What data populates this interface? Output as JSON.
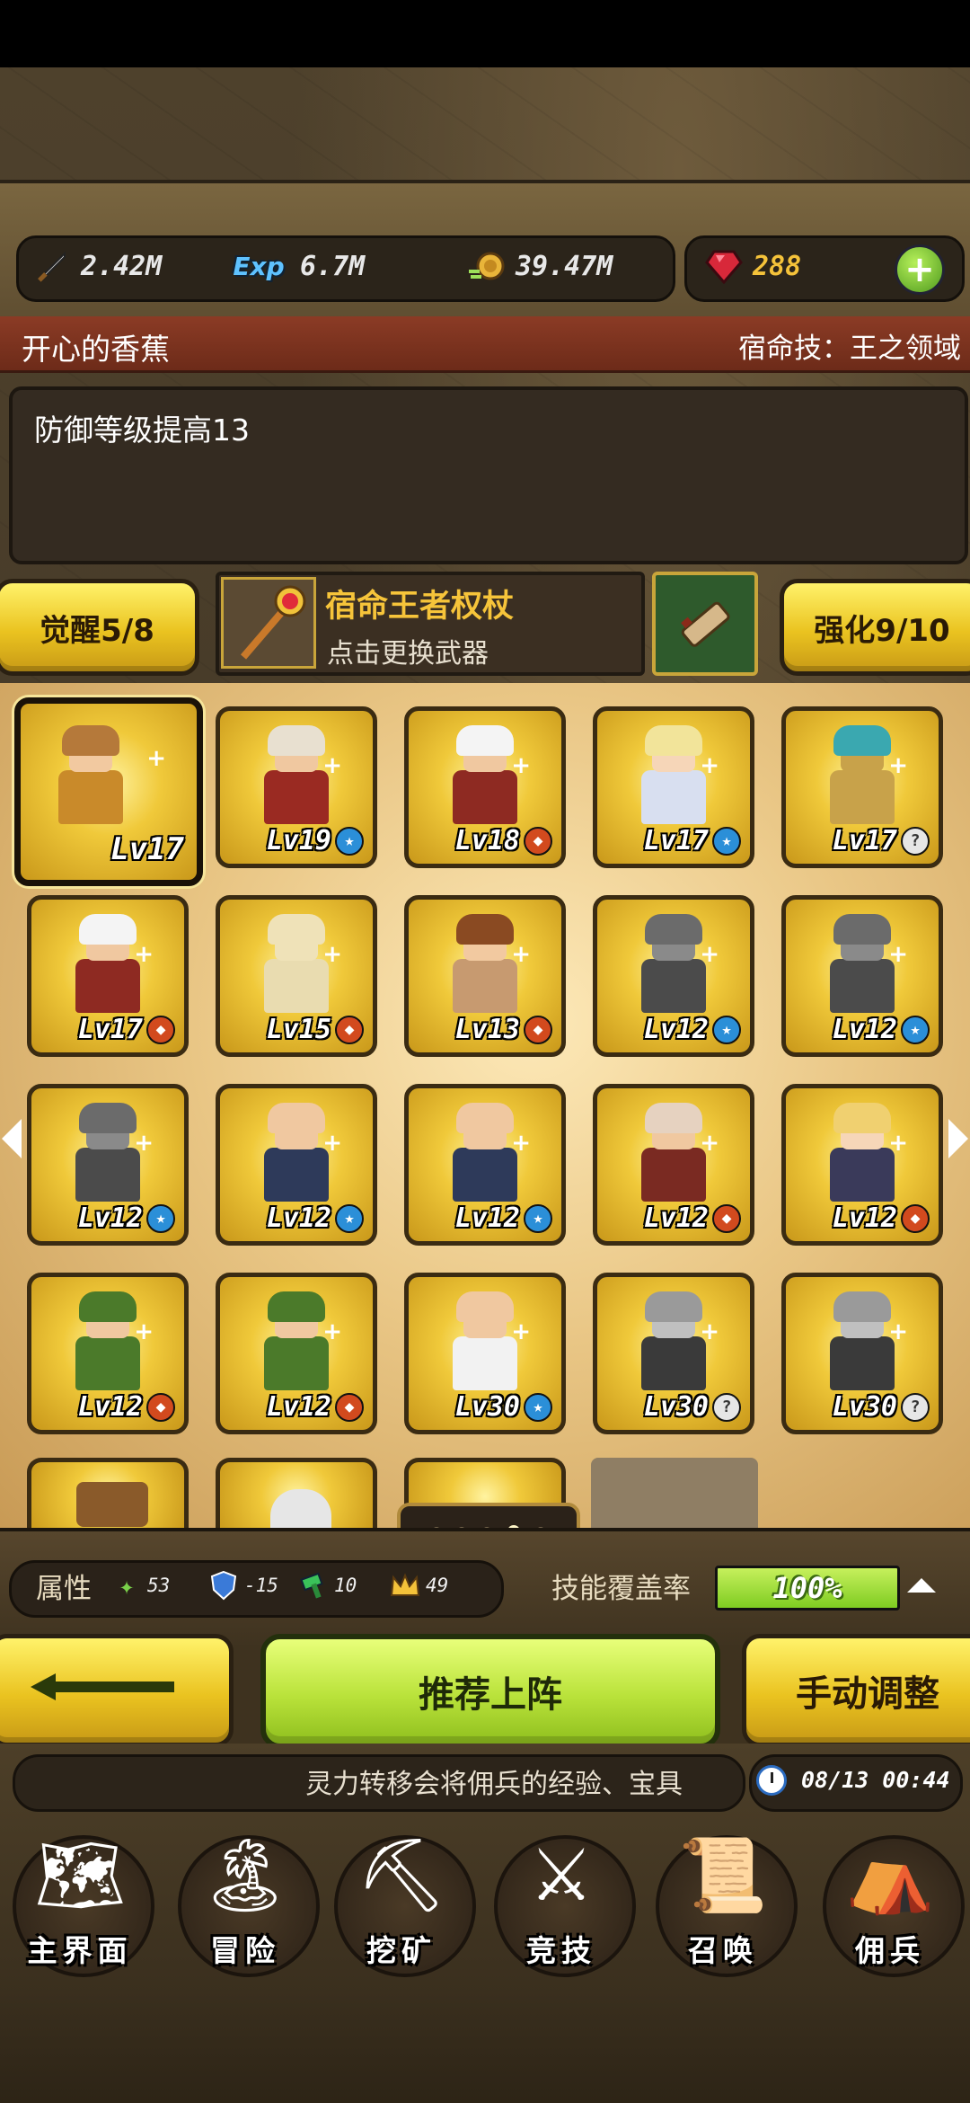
{
  "resources": {
    "attack": "2.42M",
    "exp_icon_text": "Exp",
    "exp": "6.7M",
    "gold": "39.47M",
    "gems": "288",
    "plus": "+"
  },
  "hero": {
    "name": "开心的香蕉",
    "fate_skill": "宿命技：王之领域",
    "description": "防御等级提高13"
  },
  "awaken": {
    "label": "觉醒5/8"
  },
  "enhance": {
    "label": "强化9/10"
  },
  "weapon": {
    "title": "宿命王者权杖",
    "subtitle": "点击更换武器"
  },
  "cards": [
    {
      "level": "Lv17",
      "badge": "",
      "hair": "#b5793a",
      "body": "#c98a2a",
      "skin": "#f2c9a0"
    },
    {
      "level": "Lv19",
      "badge": "★",
      "badge_type": "blue",
      "hair": "#e8e0d0",
      "body": "#9a2a22",
      "skin": "#f0c8a0"
    },
    {
      "level": "Lv18",
      "badge": "◆",
      "badge_type": "red",
      "hair": "#f4f4f4",
      "body": "#8e2a22",
      "skin": "#f0c8a0"
    },
    {
      "level": "Lv17",
      "badge": "★",
      "badge_type": "blue",
      "hair": "#f2e49a",
      "body": "#d8dff0",
      "skin": "#f6d6b8"
    },
    {
      "level": "Lv17",
      "badge": "?",
      "badge_type": "gray",
      "hair": "#3aa8b0",
      "body": "#c8a24a",
      "skin": "#c8a24a"
    },
    {
      "level": "Lv17",
      "badge": "◆",
      "badge_type": "red",
      "hair": "#f4f4f4",
      "body": "#8e2a22",
      "skin": "#f0c8a0"
    },
    {
      "level": "Lv15",
      "badge": "◆",
      "badge_type": "red",
      "hair": "#efe2b8",
      "body": "#e9dcb0",
      "skin": "#efe2b8"
    },
    {
      "level": "Lv13",
      "badge": "◆",
      "badge_type": "red",
      "hair": "#8a4a22",
      "body": "#c79a70",
      "skin": "#f2c9a0"
    },
    {
      "level": "Lv12",
      "badge": "★",
      "badge_type": "blue",
      "hair": "#6b6b6b",
      "body": "#4b4b4b",
      "skin": "#8a8a8a"
    },
    {
      "level": "Lv12",
      "badge": "★",
      "badge_type": "blue",
      "hair": "#6b6b6b",
      "body": "#4b4b4b",
      "skin": "#8a8a8a"
    },
    {
      "level": "Lv12",
      "badge": "★",
      "badge_type": "blue",
      "hair": "#6b6b6b",
      "body": "#4b4b4b",
      "skin": "#8a8a8a"
    },
    {
      "level": "Lv12",
      "badge": "★",
      "badge_type": "blue",
      "hair": "#f0c8a0",
      "body": "#2e3a5a",
      "skin": "#f0c8a0"
    },
    {
      "level": "Lv12",
      "badge": "★",
      "badge_type": "blue",
      "hair": "#f0c8a0",
      "body": "#2e3a5a",
      "skin": "#f0c8a0"
    },
    {
      "level": "Lv12",
      "badge": "◆",
      "badge_type": "red",
      "hair": "#e6d2c0",
      "body": "#7a2a22",
      "skin": "#f0c8a0"
    },
    {
      "level": "Lv12",
      "badge": "◆",
      "badge_type": "red",
      "hair": "#f0d070",
      "body": "#3a3a5a",
      "skin": "#f6d6b8"
    },
    {
      "level": "Lv12",
      "badge": "◆",
      "badge_type": "red",
      "hair": "#4b7a2a",
      "body": "#4b7a2a",
      "skin": "#f0c8a0"
    },
    {
      "level": "Lv12",
      "badge": "◆",
      "badge_type": "red",
      "hair": "#4b7a2a",
      "body": "#4b7a2a",
      "skin": "#f0c8a0"
    },
    {
      "level": "Lv30",
      "badge": "★",
      "badge_type": "blue",
      "hair": "#f0c8a0",
      "body": "#f2f2f2",
      "skin": "#f0c8a0"
    },
    {
      "level": "Lv30",
      "badge": "?",
      "badge_type": "gray",
      "hair": "#9a9a9a",
      "body": "#3a3a3a",
      "skin": "#c0c0c0"
    },
    {
      "level": "Lv30",
      "badge": "?",
      "badge_type": "gray",
      "hair": "#9a9a9a",
      "body": "#3a3a3a",
      "skin": "#c0c0c0"
    }
  ],
  "page_dots": {
    "count": 5,
    "active": 3
  },
  "stats": {
    "label": "属性",
    "values": [
      "53",
      "-15",
      "10",
      "49"
    ],
    "coverage_label": "技能覆盖率",
    "coverage_value": "100%",
    "coverage_fraction": 1.0
  },
  "actions": {
    "recommend": "推荐上阵",
    "manual": "手动调整"
  },
  "ticker": {
    "text": "灵力转移会将佣兵的经验、宝具",
    "datetime": "08/13 00:44"
  },
  "nav": [
    {
      "label": "主界面",
      "icon": "map-scroll-icon",
      "glyph": "🗺"
    },
    {
      "label": "冒险",
      "icon": "island-icon",
      "glyph": "🏝"
    },
    {
      "label": "挖矿",
      "icon": "pickaxe-icon",
      "glyph": "⛏"
    },
    {
      "label": "竞技",
      "icon": "crossed-swords-icon",
      "glyph": "⚔"
    },
    {
      "label": "召唤",
      "icon": "summon-scroll-icon",
      "glyph": "📜"
    },
    {
      "label": "佣兵",
      "icon": "tent-icon",
      "glyph": "⛺"
    }
  ]
}
